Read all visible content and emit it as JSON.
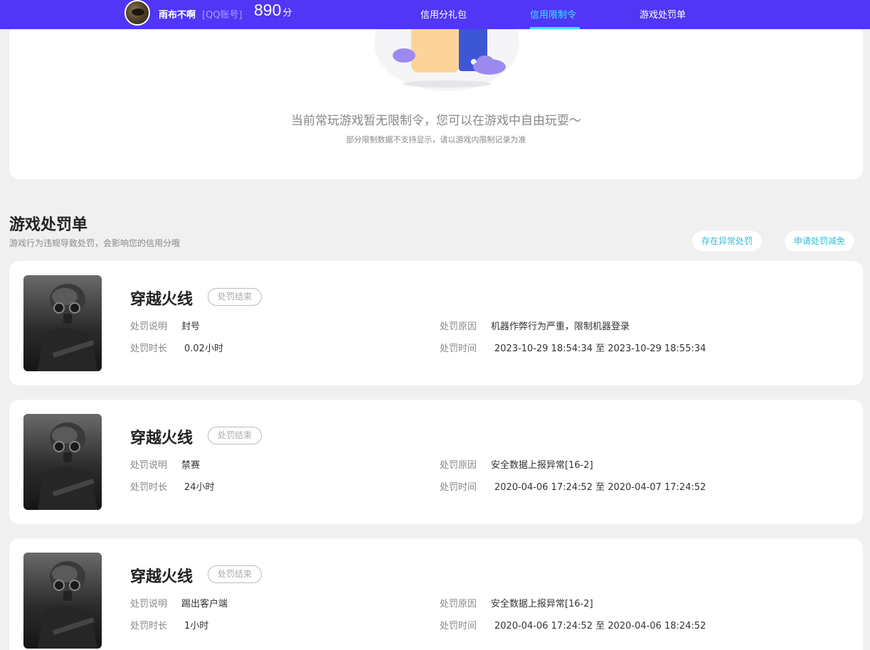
{
  "header": {
    "nickname": "雨布不啊",
    "account_tag": "[QQ账号]",
    "score": "890",
    "score_unit": "分",
    "nav": [
      {
        "label": "信用分礼包",
        "active": false
      },
      {
        "label": "信用限制令",
        "active": true
      },
      {
        "label": "游戏处罚单",
        "active": false
      }
    ],
    "accent_color": "#5136f5",
    "active_color": "#36e8ff"
  },
  "restriction": {
    "message": "当前常玩游戏暂无限制令，您可以在游戏中自由玩耍～",
    "note": "部分限制数据不支持显示，请以游戏内限制记录为准"
  },
  "penalties": {
    "title": "游戏处罚单",
    "subtitle": "游戏行为违规导致处罚，会影响您的信用分哦",
    "actions": [
      "存在异常处罚",
      "申请处罚减免"
    ],
    "labels": {
      "desc": "处罚说明",
      "duration": "处罚时长",
      "reason": "处罚原因",
      "time": "处罚时间"
    },
    "items": [
      {
        "game": "穿越火线",
        "status": "处罚结束",
        "desc": "封号",
        "duration": "0.02小时",
        "reason": "机器作弊行为严重，限制机器登录",
        "time": "2023-10-29 18:54:34 至 2023-10-29 18:55:34"
      },
      {
        "game": "穿越火线",
        "status": "处罚结束",
        "desc": "禁赛",
        "duration": "24小时",
        "reason": "安全数据上报异常[16-2]",
        "time": "2020-04-06 17:24:52 至 2020-04-07 17:24:52"
      },
      {
        "game": "穿越火线",
        "status": "处罚结束",
        "desc": "踢出客户端",
        "duration": "1小时",
        "reason": "安全数据上报异常[16-2]",
        "time": "2020-04-06 17:24:52 至 2020-04-06 18:24:52"
      }
    ]
  }
}
